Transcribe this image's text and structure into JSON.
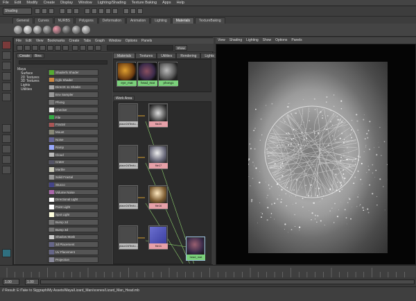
{
  "menubar": [
    "File",
    "Edit",
    "Modify",
    "Create",
    "Display",
    "Window",
    "Lighting/Shading",
    "Texture Baking",
    "Apps",
    "Help"
  ],
  "status": {
    "mode": "Shading"
  },
  "shelf_tabs": [
    "General",
    "Curves",
    "NURBS",
    "Polygons",
    "Deformation",
    "Animation",
    "Lighting",
    "Materials",
    "TextureBaking"
  ],
  "shelf_active": "Materials",
  "hypershade": {
    "menu": [
      "File",
      "Edit",
      "View",
      "Bookmarks",
      "Create",
      "Tabs",
      "Graph",
      "Window",
      "Options",
      "Panels"
    ],
    "show_label": "Show",
    "left_tabs": [
      "Create",
      "Bins"
    ],
    "tree": [
      "Maya",
      "Surface",
      "2D Textures",
      "3D Textures",
      "Lights",
      "Utilities"
    ],
    "nodes": [
      "Shaderfx Shader",
      "Cgfx Shader",
      "DirectX 11 Shader",
      "Env Sampler",
      "Phong",
      "Checker",
      "File",
      "Fractal",
      "Mount",
      "Noise",
      "Ramp",
      "Cloud",
      "Crater",
      "Marble",
      "Solid Fractal",
      "Stucco",
      "Volume Noise",
      "Directional Light",
      "Point Light",
      "Spot Light",
      "Bump 2d",
      "Bump 3d",
      "Shadow Mask",
      "3d Placement",
      "Uv Placement",
      "Projection"
    ],
    "right_tabs": [
      "Materials",
      "Textures",
      "Utilities",
      "Rendering",
      "Lights"
    ],
    "materials": [
      "eye_mat",
      "head_mat",
      "phong1"
    ],
    "work_area_label": "Work Area",
    "graph_nodes": [
      "place2dTextu...",
      "file20",
      "place2dTextu...",
      "file17",
      "place2dTextu...",
      "file16",
      "place2dTextu...",
      "file11",
      "head_mat"
    ]
  },
  "viewport": {
    "menu": [
      "View",
      "Shading",
      "Lighting",
      "Show",
      "Options",
      "Panels"
    ]
  },
  "range": {
    "start": "1.00",
    "current": "1.00"
  },
  "command_line": "// Result: E:/Take to Siggraph/My Assets/Maya/Lizard_Man/scenes/Lizard_Man_Head.mb"
}
